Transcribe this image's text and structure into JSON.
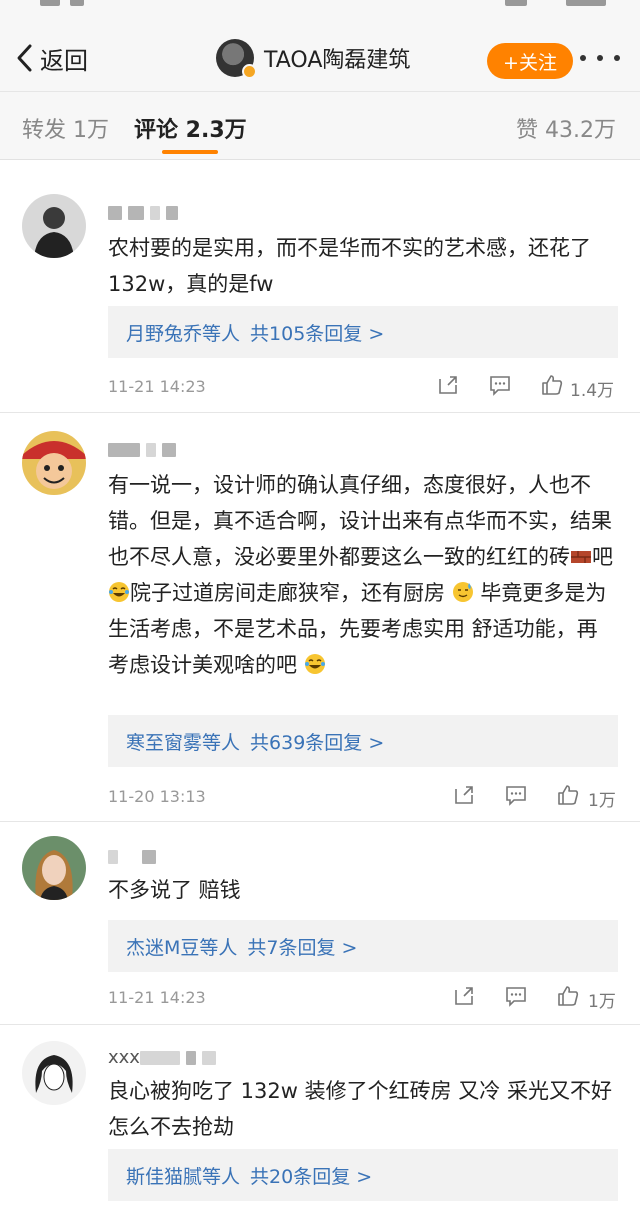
{
  "nav": {
    "back_label": "返回",
    "title": "TAOA陶磊建筑",
    "follow_label": "+关注"
  },
  "tabs": {
    "repost": "转发 1万",
    "comment": "评论 2.3万",
    "like": "赞 43.2万"
  },
  "comments": [
    {
      "text": "农村要的是实用，而不是华而不实的艺术感，还花了132w，真的是fw",
      "reply_names": "月野兔乔等人",
      "reply_count": "共105条回复 >",
      "time": "11-21 14:23",
      "likes": "1.4万"
    },
    {
      "text_parts": [
        "有一说一，设计师的确认真仔细，态度很好，人也不错。但是，真不适合啊，设计出来有点华而不实，结果也不尽人意，没必要里外都要这么一致的红红的砖",
        "吧",
        "院子过道房间走廊狭窄，还有厨房",
        "毕竟更多是为生活考虑，不是艺术品，先要考虑实用 舒适功能，再考虑设计美观啥的吧"
      ],
      "reply_names": "寒至窗雾等人",
      "reply_count": "共639条回复 >",
      "time": "11-20 13:13",
      "likes": "1万"
    },
    {
      "text": "不多说了 赔钱",
      "reply_names": "杰迷M豆等人",
      "reply_count": "共7条回复 >",
      "time": "11-21 14:23",
      "likes": "1万"
    },
    {
      "name_prefix": "xxx",
      "text": "良心被狗吃了 132w 装修了个红砖房 又冷 采光又不好 怎么不去抢劫",
      "reply_names": "斯佳猫腻等人",
      "reply_count": "共20条回复 >"
    }
  ],
  "colors": {
    "accent": "#ff8200",
    "link": "#3a73b7",
    "reply_bg": "#f2f2f2",
    "meta": "#999999"
  },
  "icons": [
    "back-chevron-icon",
    "more-dots-icon",
    "share-icon",
    "comment-icon",
    "like-thumb-icon",
    "brick-emoji-icon",
    "laugh-cry-emoji-icon",
    "sweat-smile-emoji-icon"
  ]
}
